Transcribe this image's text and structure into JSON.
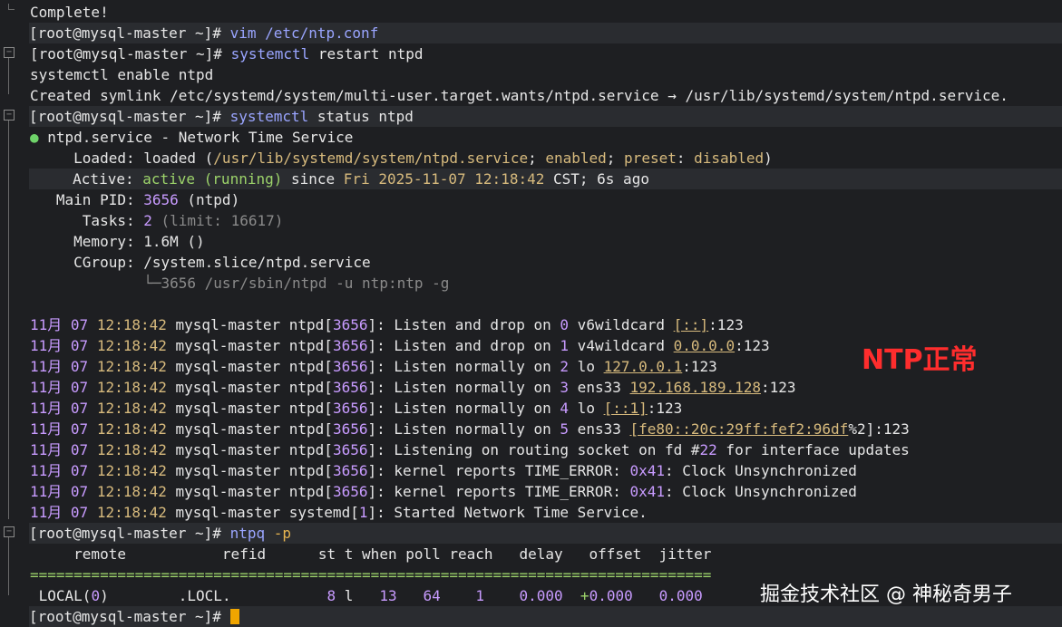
{
  "lines": {
    "l0": "Complete!",
    "l1_prompt": "[root@mysql-master ~]# ",
    "l1_cmd": "vim /etc/ntp.conf",
    "l2_prompt": "[root@mysql-master ~]# ",
    "l2_cmd": "systemctl restart ntpd",
    "l3": "systemctl enable ntpd",
    "l4": "Created symlink /etc/systemd/system/multi-user.target.wants/ntpd.service → /usr/lib/systemd/system/ntpd.service.",
    "l5_prompt": "[root@mysql-master ~]# ",
    "l5_cmd": "systemctl status ntpd",
    "l6_bullet": "●",
    "l6_text": " ntpd.service - Network Time Service",
    "l7_label": "     Loaded: ",
    "l7_a": "loaded (",
    "l7_b": "/usr/lib/systemd/system/ntpd.service",
    "l7_c": "; ",
    "l7_d": "enabled",
    "l7_e": "; ",
    "l7_f": "preset",
    "l7_g": ": ",
    "l7_h": "disabled",
    "l7_i": ")",
    "l8_label": "     Active: ",
    "l8_a": "active (running)",
    "l8_b": " since ",
    "l8_c": "Fri 2025-11-07 12:18:42",
    "l8_d": " CST; 6s ago",
    "l9_label": "   Main PID: ",
    "l9_a": "3656",
    "l9_b": " (ntpd)",
    "l10_label": "      Tasks: ",
    "l10_a": "2",
    "l10_b": " (limit: ",
    "l10_c": "16617",
    "l10_d": ")",
    "l11_label": "     Memory: ",
    "l11_a": "1.6M ()",
    "l12_label": "     CGroup: ",
    "l12_a": "/system.slice/ntpd.service",
    "l13": "             └─3656 /usr/sbin/ntpd -u ntp:ntp -g"
  },
  "logs": [
    {
      "date": "11月",
      "day": "07",
      "time": "12:18:42",
      "host": "mysql-master",
      "proc": "ntpd",
      "pid": "3656",
      "msg1": ": Listen and drop on ",
      "n": "0",
      "msg2": " v6wildcard ",
      "addr": "[::]",
      "tail": ":123"
    },
    {
      "date": "11月",
      "day": "07",
      "time": "12:18:42",
      "host": "mysql-master",
      "proc": "ntpd",
      "pid": "3656",
      "msg1": ": Listen and drop on ",
      "n": "1",
      "msg2": " v4wildcard ",
      "addr": "0.0.0.0",
      "tail": ":123"
    },
    {
      "date": "11月",
      "day": "07",
      "time": "12:18:42",
      "host": "mysql-master",
      "proc": "ntpd",
      "pid": "3656",
      "msg1": ": Listen normally on ",
      "n": "2",
      "msg2": " lo ",
      "addr": "127.0.0.1",
      "tail": ":123"
    },
    {
      "date": "11月",
      "day": "07",
      "time": "12:18:42",
      "host": "mysql-master",
      "proc": "ntpd",
      "pid": "3656",
      "msg1": ": Listen normally on ",
      "n": "3",
      "msg2": " ens33 ",
      "addr": "192.168.189.128",
      "tail": ":123"
    },
    {
      "date": "11月",
      "day": "07",
      "time": "12:18:42",
      "host": "mysql-master",
      "proc": "ntpd",
      "pid": "3656",
      "msg1": ": Listen normally on ",
      "n": "4",
      "msg2": " lo ",
      "addr": "[::1]",
      "tail": ":123"
    },
    {
      "date": "11月",
      "day": "07",
      "time": "12:18:42",
      "host": "mysql-master",
      "proc": "ntpd",
      "pid": "3656",
      "msg1": ": Listen normally on ",
      "n": "5",
      "msg2": " ens33 ",
      "addr": "[fe80::20c:29ff:fef2:96df",
      "tail": "%2]:123"
    },
    {
      "date": "11月",
      "day": "07",
      "time": "12:18:42",
      "host": "mysql-master",
      "proc": "ntpd",
      "pid": "3656",
      "msg1": ": Listening on routing socket on fd #",
      "n": "22",
      "msg2": " for interface updates",
      "addr": "",
      "tail": ""
    },
    {
      "date": "11月",
      "day": "07",
      "time": "12:18:42",
      "host": "mysql-master",
      "proc": "ntpd",
      "pid": "3656",
      "msg1": ": kernel reports TIME_ERROR: ",
      "n": "0x41",
      "msg2": ": Clock Unsynchronized",
      "addr": "",
      "tail": ""
    },
    {
      "date": "11月",
      "day": "07",
      "time": "12:18:42",
      "host": "mysql-master",
      "proc": "ntpd",
      "pid": "3656",
      "msg1": ": kernel reports TIME_ERROR: ",
      "n": "0x41",
      "msg2": ": Clock Unsynchronized",
      "addr": "",
      "tail": ""
    },
    {
      "date": "11月",
      "day": "07",
      "time": "12:18:42",
      "host": "mysql-master",
      "proc": "systemd",
      "pid": "1",
      "msg1": ": Started Network Time Service.",
      "n": "",
      "msg2": "",
      "addr": "",
      "tail": ""
    }
  ],
  "ntpq": {
    "prompt": "[root@mysql-master ~]# ",
    "cmd": "ntpq -p",
    "header": "     remote           refid      st t when poll reach   delay   offset  jitter",
    "rule": "==============================================================================",
    "row_a": " LOCAL(",
    "row_b": "0",
    "row_c": ")        .LOCL.          ",
    "row_st": " 8",
    "row_t": " l",
    "row_when": "   13",
    "row_poll": "   64",
    "row_reach": "    1",
    "row_delay": "    0.000",
    "row_offset_sign": "  +",
    "row_offset": "0.000",
    "row_jitter": "   0.000",
    "final_prompt": "[root@mysql-master ~]# "
  },
  "annotation": "NTP正常",
  "watermark": "掘金技术社区 @ 神秘奇男子"
}
